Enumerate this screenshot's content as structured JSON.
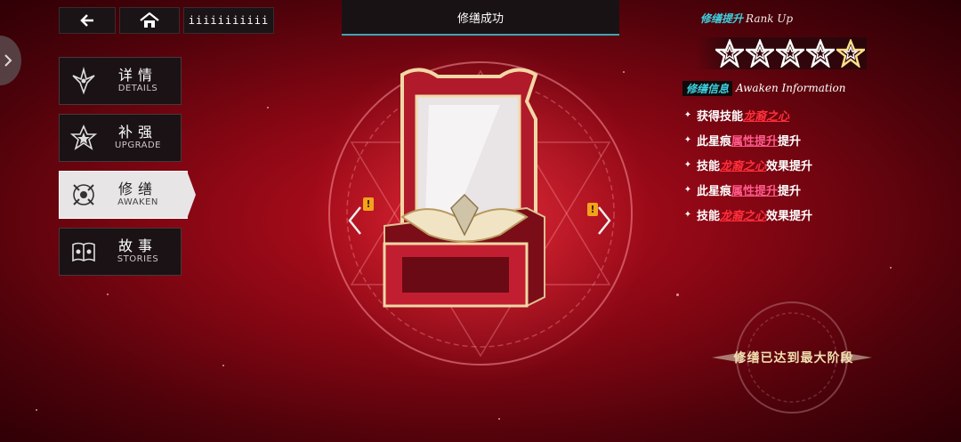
{
  "topbar": {
    "back_icon": "back-arrow-icon",
    "home_icon": "home-icon",
    "title": "iiiiiiiiiii"
  },
  "menu": [
    {
      "cn": "详情",
      "en": "DETAILS",
      "icon": "lily-icon"
    },
    {
      "cn": "补强",
      "en": "UPGRADE",
      "icon": "star-badge-icon"
    },
    {
      "cn": "修缮",
      "en": "AWAKEN",
      "icon": "crest-icon",
      "active": true
    },
    {
      "cn": "故事",
      "en": "STORIES",
      "icon": "book-icon"
    }
  ],
  "banner": {
    "title": "修缮成功"
  },
  "rank": {
    "label_cn": "修缮提升",
    "label_en": "Rank Up",
    "stars_total": 5,
    "stars_lit": 5
  },
  "awaken_info": {
    "label_cn": "修缮信息",
    "label_en": "Awaken Information",
    "items": [
      {
        "pre": "获得技能",
        "hl": "龙裔之心",
        "post": "",
        "hl_style": "red"
      },
      {
        "pre": "此星痕",
        "hl": "属性提升",
        "post": "提升",
        "hl_style": "pink"
      },
      {
        "pre": "技能",
        "hl": "龙裔之心",
        "post": "效果提升",
        "hl_style": "red"
      },
      {
        "pre": "此星痕",
        "hl": "属性提升",
        "post": "提升",
        "hl_style": "pink"
      },
      {
        "pre": "技能",
        "hl": "龙裔之心",
        "post": "效果提升",
        "hl_style": "red"
      }
    ]
  },
  "max_stage": {
    "text": "修缮已达到最大阶段"
  },
  "colors": {
    "accent_cyan": "#3fd0df",
    "highlight_red": "#ff2f3b",
    "gold": "#f1dfb0"
  }
}
